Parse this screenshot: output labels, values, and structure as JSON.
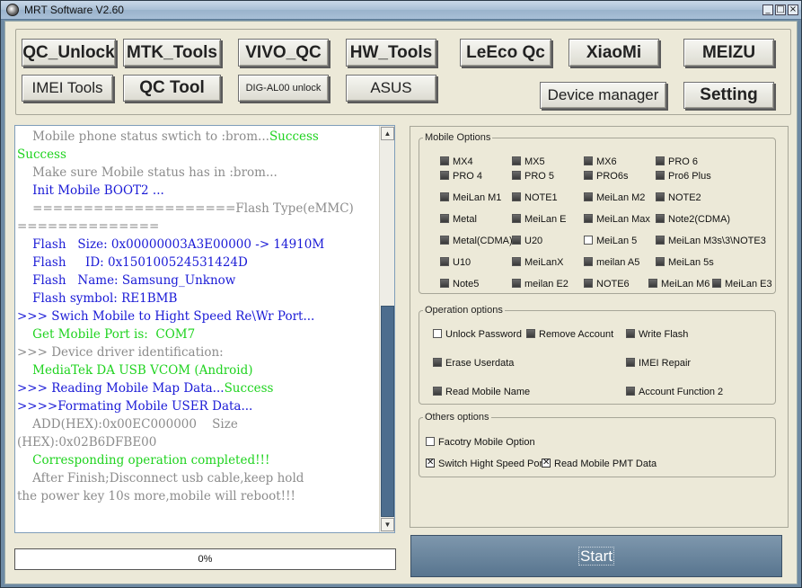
{
  "window": {
    "title": "MRT Software V2.60"
  },
  "titlebar": {
    "minimize": "_",
    "maximize": "□",
    "close": "×"
  },
  "toolbar": {
    "qc_unlock": "QC_Unlock",
    "mtk_tools": "MTK_Tools",
    "vivo_qc": "VIVO_QC",
    "hw_tools": "HW_Tools",
    "leeco_qc": "LeEco Qc",
    "xiaomi": "XiaoMi",
    "meizu": "MEIZU",
    "imei_tools": "IMEI Tools",
    "qc_tool": "QC Tool",
    "dig_unlock": "DIG-AL00 unlock",
    "asus": "ASUS",
    "device_manager": "Device manager",
    "setting": "Setting"
  },
  "log": [
    {
      "parts": [
        {
          "t": "    Mobile phone status swtich to :brom...",
          "c": "gray"
        },
        {
          "t": "Success",
          "c": "green"
        }
      ]
    },
    {
      "parts": [
        {
          "t": "Success",
          "c": "green"
        }
      ]
    },
    {
      "parts": [
        {
          "t": "    Make sure Mobile status has in :brom...",
          "c": "gray"
        }
      ]
    },
    {
      "parts": [
        {
          "t": "    Init Mobile BOOT2 ...",
          "c": "blue"
        }
      ]
    },
    {
      "parts": [
        {
          "t": "    ====================Flash Type(eMMC)",
          "c": "gray"
        }
      ]
    },
    {
      "parts": [
        {
          "t": "==============",
          "c": "gray"
        }
      ]
    },
    {
      "parts": [
        {
          "t": "    Flash   Size: 0x00000003A3E00000 -> 14910M",
          "c": "blue"
        }
      ]
    },
    {
      "parts": [
        {
          "t": "    Flash     ID: 0x150100524531424D",
          "c": "blue"
        }
      ]
    },
    {
      "parts": [
        {
          "t": "    Flash   Name: Samsung_Unknow",
          "c": "blue"
        }
      ]
    },
    {
      "parts": [
        {
          "t": "    Flash symbol: RE1BMB",
          "c": "blue"
        }
      ]
    },
    {
      "parts": [
        {
          "t": ">>> Swich Mobile to Hight Speed Re\\Wr Port...",
          "c": "blue"
        }
      ]
    },
    {
      "parts": [
        {
          "t": "    Get Mobile Port is:  COM7",
          "c": "green"
        }
      ]
    },
    {
      "parts": [
        {
          "t": ">>> Device driver identification:",
          "c": "gray"
        }
      ]
    },
    {
      "parts": [
        {
          "t": "    MediaTek DA USB VCOM (Android)",
          "c": "green"
        }
      ]
    },
    {
      "parts": [
        {
          "t": ">>> Reading Mobile Map Data...",
          "c": "blue"
        },
        {
          "t": "Success",
          "c": "green"
        }
      ]
    },
    {
      "parts": [
        {
          "t": ">>>>Formating Mobile USER Data...",
          "c": "blue"
        }
      ]
    },
    {
      "parts": [
        {
          "t": "    ADD(HEX):0x00EC000000    Size",
          "c": "gray"
        }
      ]
    },
    {
      "parts": [
        {
          "t": "(HEX):0x02B6DFBE00",
          "c": "gray"
        }
      ]
    },
    {
      "parts": [
        {
          "t": "    Corresponding operation completed!!!",
          "c": "green"
        }
      ]
    },
    {
      "parts": [
        {
          "t": "    After Finish;Disconnect usb cable,keep hold",
          "c": "gray"
        }
      ]
    },
    {
      "parts": [
        {
          "t": "the power key 10s more,mobile will reboot!!!",
          "c": "gray"
        }
      ]
    }
  ],
  "progress": {
    "label": "0%",
    "value": 0
  },
  "mobile_options": {
    "title": "Mobile Options",
    "items": [
      "MX4",
      "MX5",
      "MX6",
      "PRO 6",
      "PRO 4",
      "PRO 5",
      "PRO6s",
      "Pro6 Plus",
      "MeiLan M1",
      "NOTE1",
      "MeiLan M2",
      "NOTE2",
      "Metal",
      "MeiLan E",
      "MeiLan Max",
      "Note2(CDMA)",
      "Metal(CDMA)",
      "U20",
      "MeiLan 5",
      "MeiLan M3s\\3\\NOTE3",
      "U10",
      "MeiLanX",
      "meilan A5",
      "MeiLan 5s",
      "Note5",
      "meilan E2",
      "NOTE6",
      "MeiLan M6",
      "MeiLan E3"
    ]
  },
  "operation_options": {
    "title": "Operation options",
    "unlock_password": "Unlock Password",
    "remove_account": "Remove Account",
    "write_flash": "Write Flash",
    "erase_userdata": "Erase Userdata",
    "imei_repair": "IMEI Repair",
    "read_mobile_name": "Read Mobile Name",
    "account_function_2": "Account Function 2"
  },
  "others_options": {
    "title": "Others options",
    "factory_mobile_option": "Facotry Mobile Option",
    "switch_high_speed": "Switch Hight Speed Por",
    "read_mobile_pmt": "Read Mobile PMT Data"
  },
  "start": {
    "label": "Start"
  }
}
